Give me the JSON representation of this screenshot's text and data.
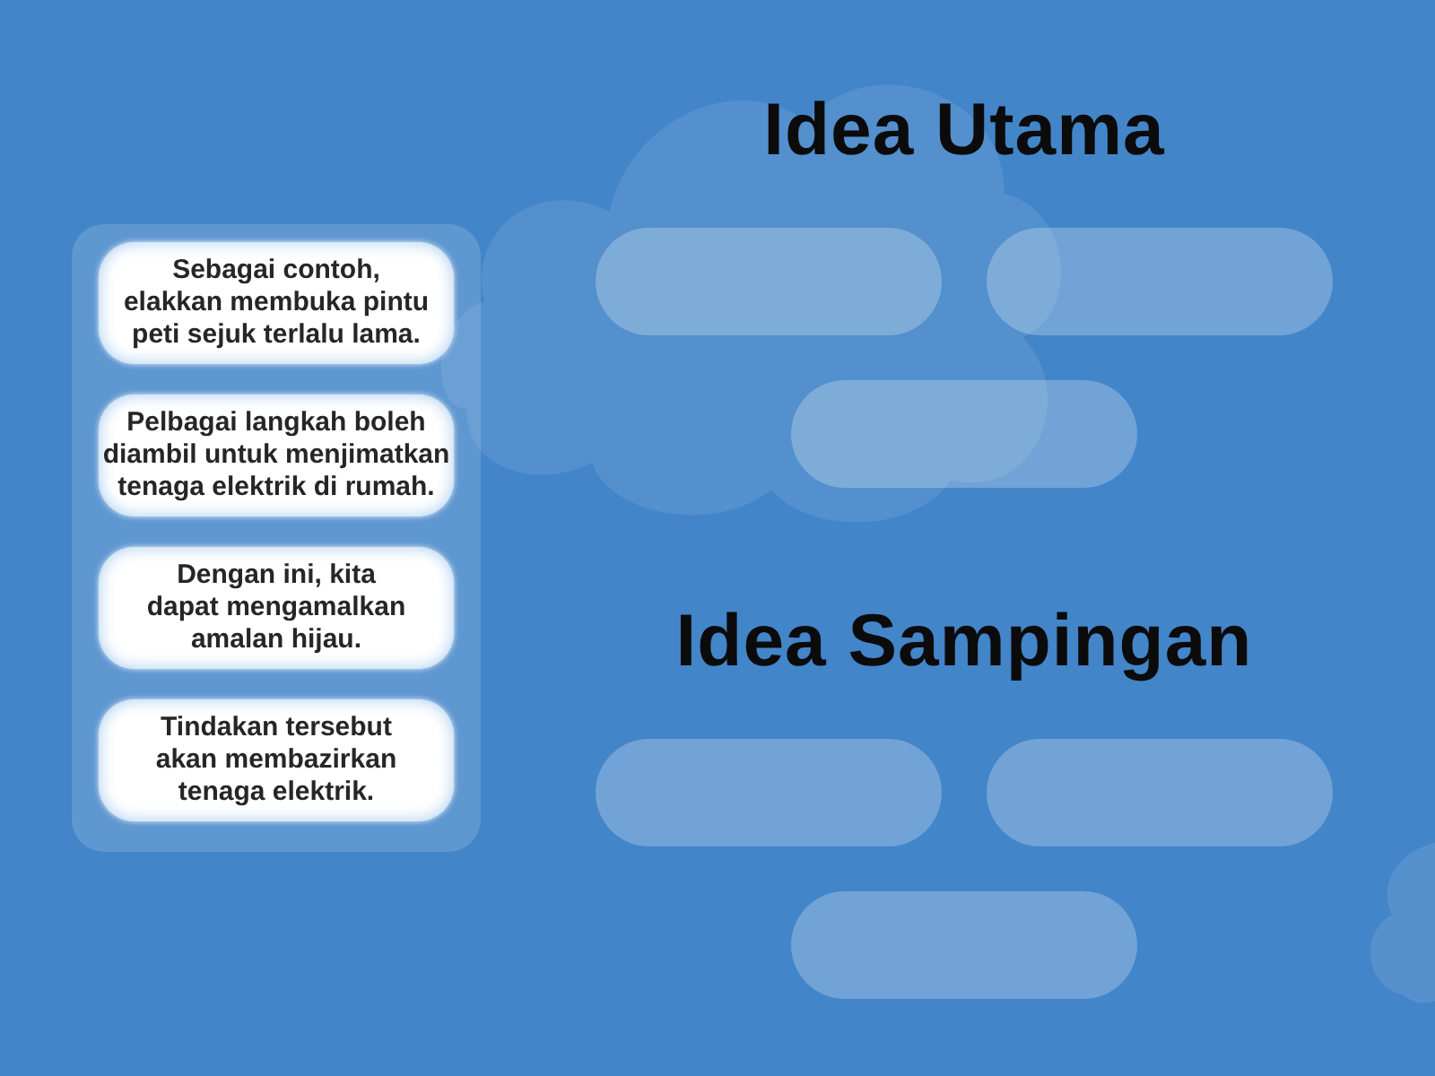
{
  "cards": [
    {
      "text": "Sebagai contoh,\nelakkan membuka pintu\npeti sejuk terlalu lama."
    },
    {
      "text": "Pelbagai langkah boleh\ndiambil untuk menjimatkan\ntenaga elektrik di rumah."
    },
    {
      "text": "Dengan ini, kita\ndapat mengamalkan\namalan hijau."
    },
    {
      "text": "Tindakan tersebut\nakan membazirkan\ntenaga elektrik."
    }
  ],
  "groups": [
    {
      "title": "Idea Utama",
      "slots": [
        {
          "kind": "empty"
        },
        {
          "kind": "empty"
        },
        {
          "kind": "empty"
        }
      ]
    },
    {
      "title": "Idea Sampingan",
      "slots": [
        {
          "kind": "empty"
        },
        {
          "kind": "empty"
        },
        {
          "kind": "empty"
        }
      ]
    }
  ]
}
